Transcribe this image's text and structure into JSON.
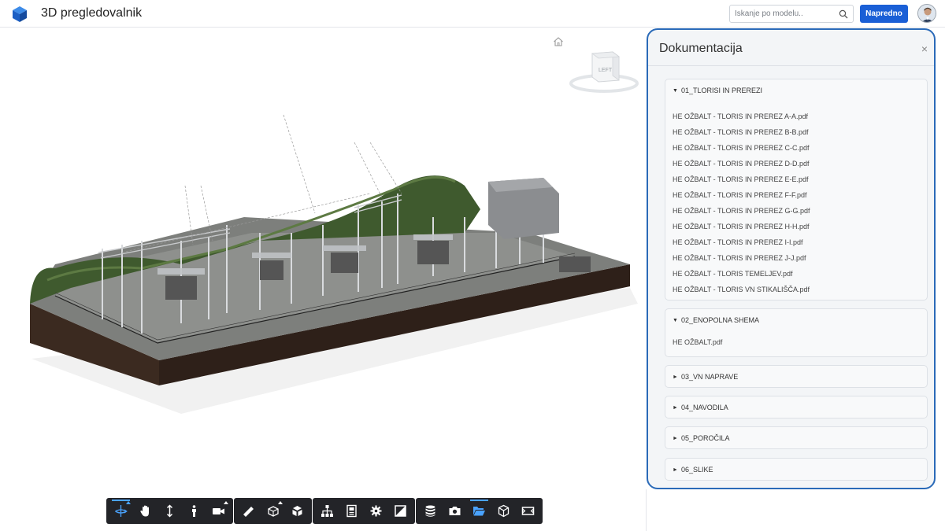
{
  "header": {
    "title": "3D pregledovalnik",
    "search_placeholder": "Iskanje po modelu..",
    "advanced_label": "Napredno"
  },
  "viewer": {
    "viewcube_label": "LEFT"
  },
  "toolbar": {
    "groups": [
      [
        "orbit-icon",
        "pan-hand-icon",
        "zoom-icon",
        "first-person-icon",
        "camera-icon"
      ],
      [
        "measure-icon",
        "section-icon",
        "explode-icon"
      ],
      [
        "model-browser-icon",
        "properties-icon",
        "settings-icon",
        "fullscreen-icon"
      ],
      [
        "layers-icon",
        "screenshot-icon",
        "documents-folder-icon",
        "cube-icon",
        "view-icon"
      ]
    ]
  },
  "panel": {
    "title": "Dokumentacija",
    "close": "×",
    "folders": [
      {
        "label": "01_TLORISI IN PREREZI",
        "expanded": true,
        "files": [
          "HE OŽBALT - TLORIS IN PREREZ A-A.pdf",
          "HE OŽBALT - TLORIS IN PREREZ B-B.pdf",
          "HE OŽBALT - TLORIS IN PREREZ C-C.pdf",
          "HE OŽBALT - TLORIS IN PREREZ D-D.pdf",
          "HE OŽBALT - TLORIS IN PREREZ E-E.pdf",
          "HE OŽBALT - TLORIS IN PREREZ F-F.pdf",
          "HE OŽBALT - TLORIS IN PREREZ G-G.pdf",
          "HE OŽBALT - TLORIS IN PREREZ H-H.pdf",
          "HE OŽBALT - TLORIS IN PREREZ I-I.pdf",
          "HE OŽBALT - TLORIS IN PREREZ J-J.pdf",
          "HE OŽBALT - TLORIS TEMELJEV.pdf",
          "HE OŽBALT - TLORIS VN STIKALIŠČA.pdf"
        ]
      },
      {
        "label": "02_ENOPOLNA SHEMA",
        "expanded": true,
        "files": [
          "HE OŽBALT.pdf"
        ]
      },
      {
        "label": "03_VN NAPRAVE",
        "expanded": false,
        "files": []
      },
      {
        "label": "04_NAVODILA",
        "expanded": false,
        "files": []
      },
      {
        "label": "05_POROČILA",
        "expanded": false,
        "files": []
      },
      {
        "label": "06_SLIKE",
        "expanded": false,
        "files": []
      }
    ]
  },
  "colors": {
    "accent": "#1a5fd6",
    "panel_border": "#2a6ab8",
    "toolbar_bg": "#232428",
    "active_icon": "#4aa3ff"
  }
}
